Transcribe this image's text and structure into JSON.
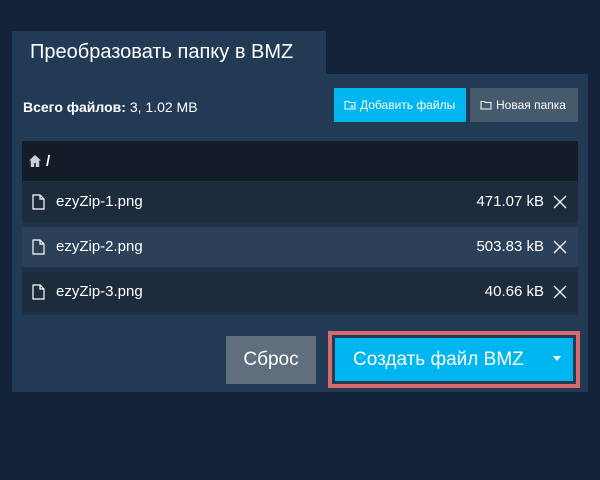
{
  "tab": {
    "title": "Преобразовать папку в BMZ"
  },
  "summary": {
    "label": "Всего файлов:",
    "value": " 3, 1.02 MB"
  },
  "toolbar": {
    "add_files_label": "Добавить файлы",
    "new_folder_label": "Новая папка"
  },
  "breadcrumb": {
    "path": "/"
  },
  "files": [
    {
      "name": "ezyZip-1.png",
      "size": "471.07 kB"
    },
    {
      "name": "ezyZip-2.png",
      "size": "503.83 kB"
    },
    {
      "name": "ezyZip-3.png",
      "size": "40.66 kB"
    }
  ],
  "actions": {
    "reset_label": "Сброс",
    "create_label": "Создать файл BMZ"
  },
  "icons": {
    "home": "home-icon",
    "file": "file-icon",
    "remove": "close-icon",
    "add_files": "folder-add-icon",
    "new_folder": "folder-icon",
    "dropdown": "caret-down-icon"
  },
  "colors": {
    "background": "#12233a",
    "panel": "#223a54",
    "accent": "#00b6f0",
    "highlight_border": "#d86a6e"
  }
}
